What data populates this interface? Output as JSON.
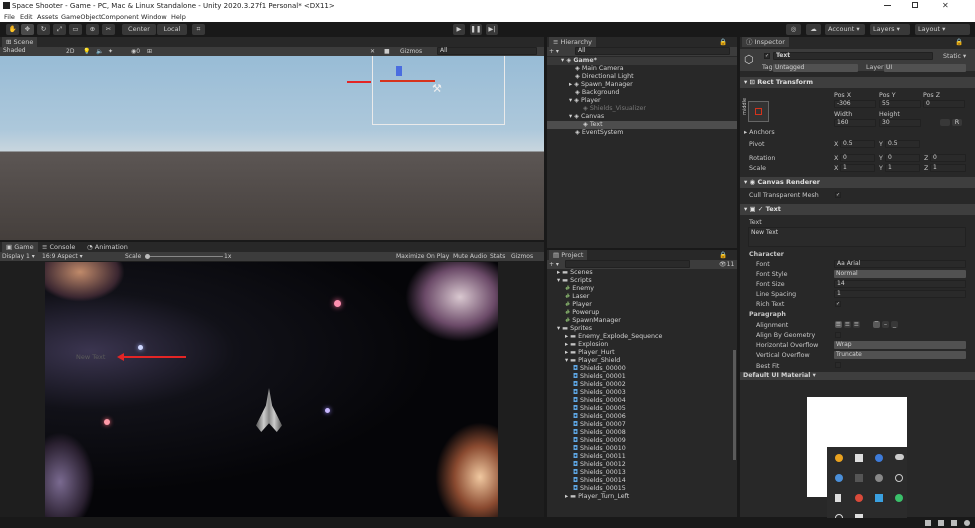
{
  "window": {
    "title": "Space Shooter - Game - PC, Mac & Linux Standalone - Unity 2020.3.27f1 Personal* <DX11>"
  },
  "menu": [
    "File",
    "Edit",
    "Assets",
    "GameObject",
    "Component",
    "Window",
    "Help"
  ],
  "toolbar": {
    "pivot": "Center",
    "space": "Local",
    "account": "Account",
    "layers": "Layers",
    "layout": "Layout"
  },
  "scene": {
    "tab": "Scene",
    "shading": "Shaded",
    "mode2d": "2D",
    "gizmos": "Gizmos",
    "search": "All"
  },
  "game": {
    "tabs": [
      "Game",
      "Console",
      "Animation"
    ],
    "display": "Display 1",
    "aspect": "16:9 Aspect",
    "scale_label": "Scale",
    "scale_value": "1x",
    "maximize": "Maximize On Play",
    "mute": "Mute Audio",
    "stats": "Stats",
    "gizmos": "Gizmos",
    "ui_text": "New Text"
  },
  "hierarchy": {
    "tab": "Hierarchy",
    "search": "All",
    "items": [
      {
        "label": "Game*"
      },
      {
        "label": "Main Camera"
      },
      {
        "label": "Directional Light"
      },
      {
        "label": "Spawn_Manager"
      },
      {
        "label": "Background"
      },
      {
        "label": "Player"
      },
      {
        "label": "Shields_Visualizer"
      },
      {
        "label": "Canvas"
      },
      {
        "label": "Text"
      },
      {
        "label": "EventSystem"
      }
    ]
  },
  "project": {
    "tab": "Project",
    "count": "11",
    "items": [
      {
        "label": "Scenes"
      },
      {
        "label": "Scripts"
      },
      {
        "label": "Enemy"
      },
      {
        "label": "Laser"
      },
      {
        "label": "Player"
      },
      {
        "label": "Powerup"
      },
      {
        "label": "SpawnManager"
      },
      {
        "label": "Sprites"
      },
      {
        "label": "Enemy_Explode_Sequence"
      },
      {
        "label": "Explosion"
      },
      {
        "label": "Player_Hurt"
      },
      {
        "label": "Player_Shield"
      },
      {
        "label": "Shields_00000"
      },
      {
        "label": "Shields_00001"
      },
      {
        "label": "Shields_00002"
      },
      {
        "label": "Shields_00003"
      },
      {
        "label": "Shields_00004"
      },
      {
        "label": "Shields_00005"
      },
      {
        "label": "Shields_00006"
      },
      {
        "label": "Shields_00007"
      },
      {
        "label": "Shields_00008"
      },
      {
        "label": "Shields_00009"
      },
      {
        "label": "Shields_00010"
      },
      {
        "label": "Shields_00011"
      },
      {
        "label": "Shields_00012"
      },
      {
        "label": "Shields_00013"
      },
      {
        "label": "Shields_00014"
      },
      {
        "label": "Shields_00015"
      },
      {
        "label": "Player_Turn_Left"
      }
    ]
  },
  "inspector": {
    "tab": "Inspector",
    "name": "Text",
    "static": "Static",
    "tag_label": "Tag",
    "tag": "Untagged",
    "layer_label": "Layer",
    "layer": "UI",
    "rect_transform": "Rect Transform",
    "anchor_preset": "middle",
    "pos_x_label": "Pos X",
    "pos_y_label": "Pos Y",
    "pos_z_label": "Pos Z",
    "pos_x": "-306",
    "pos_y": "55",
    "pos_z": "0",
    "width_label": "Width",
    "height_label": "Height",
    "width": "160",
    "height": "30",
    "anchors": "Anchors",
    "pivot_label": "Pivot",
    "pivot_x": "0.5",
    "pivot_y": "0.5",
    "rotation_label": "Rotation",
    "rot_x": "0",
    "rot_y": "0",
    "rot_z": "0",
    "scale_label": "Scale",
    "scale_x": "1",
    "scale_y": "1",
    "scale_z": "1",
    "canvas_renderer": "Canvas Renderer",
    "cull": "Cull Transparent Mesh",
    "text_component": "Text",
    "text_label": "Text",
    "text_value": "New Text",
    "character": "Character",
    "font_label": "Font",
    "font": "Arial",
    "font_style_label": "Font Style",
    "font_style": "Normal",
    "font_size_label": "Font Size",
    "font_size": "14",
    "line_spacing_label": "Line Spacing",
    "line_spacing": "1",
    "rich_text": "Rich Text",
    "paragraph": "Paragraph",
    "alignment": "Alignment",
    "align_geometry": "Align By Geometry",
    "h_overflow_label": "Horizontal Overflow",
    "h_overflow": "Wrap",
    "v_overflow_label": "Vertical Overflow",
    "v_overflow": "Truncate",
    "best_fit": "Best Fit",
    "material": "Default UI Material"
  },
  "axis_labels": {
    "x": "X",
    "y": "Y",
    "z": "Z"
  },
  "colors": {
    "accent": "#2c5d87",
    "panel": "#282828",
    "header": "#3e3e3e"
  }
}
